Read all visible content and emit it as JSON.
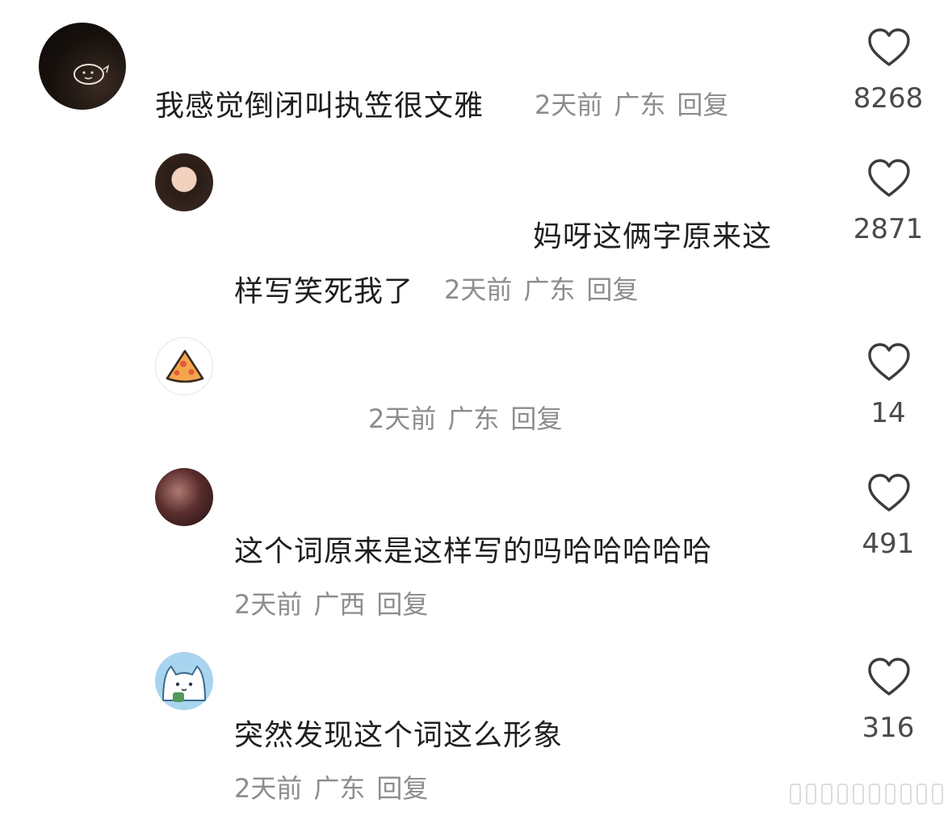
{
  "comments": [
    {
      "text": "我感觉倒闭叫执笠很文雅",
      "time": "2天前",
      "location": "广东",
      "reply": "回复",
      "likes": "8268"
    },
    {
      "text_line1": "妈呀这俩字原来这",
      "text_line2": "样写笑死我了",
      "time": "2天前",
      "location": "广东",
      "reply": "回复",
      "likes": "2871"
    },
    {
      "time": "2天前",
      "location": "广东",
      "reply": "回复",
      "likes": "14"
    },
    {
      "text": "这个词原来是这样写的吗哈哈哈哈哈",
      "time": "2天前",
      "location": "广西",
      "reply": "回复",
      "likes": "491"
    },
    {
      "text": "突然发现这个词这么形象",
      "time": "2天前",
      "location": "广东",
      "reply": "回复",
      "likes": "316"
    }
  ],
  "icons": {
    "like": "heart-outline-icon",
    "avatar3": "pizza-slice-icon",
    "avatar5": "cat-face-icon"
  },
  "colors": {
    "meta": "#8d8d8d",
    "text": "#1f1f1f",
    "heart": "#3c3c3c"
  }
}
